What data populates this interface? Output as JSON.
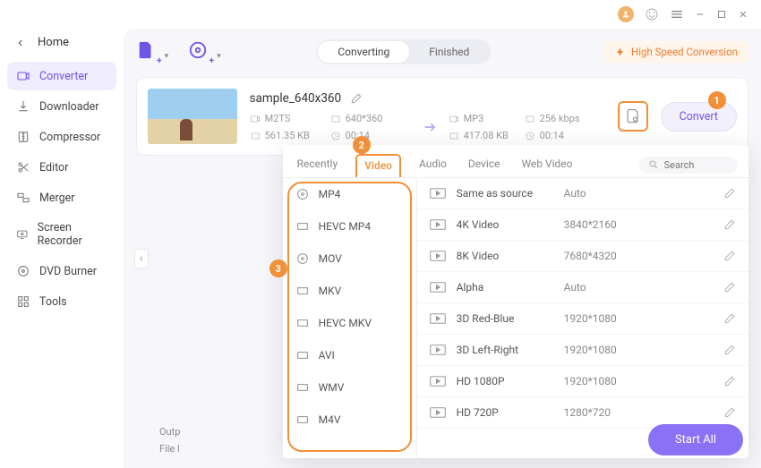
{
  "titlebar": {
    "user": "user"
  },
  "sidebar": {
    "back_label": "Home",
    "items": [
      {
        "label": "Converter"
      },
      {
        "label": "Downloader"
      },
      {
        "label": "Compressor"
      },
      {
        "label": "Editor"
      },
      {
        "label": "Merger"
      },
      {
        "label": "Screen Recorder"
      },
      {
        "label": "DVD Burner"
      },
      {
        "label": "Tools"
      }
    ]
  },
  "toprow": {
    "tabs": {
      "converting": "Converting",
      "finished": "Finished"
    },
    "highspeed": "High Speed Conversion"
  },
  "filecard": {
    "name": "sample_640x360",
    "src": {
      "fmt": "M2TS",
      "res": "640*360",
      "size": "561.35 KB",
      "dur": "00:14"
    },
    "dst": {
      "fmt": "MP3",
      "bitrate": "256 kbps",
      "size": "417.08 KB",
      "dur": "00:14"
    },
    "convert_label": "Convert"
  },
  "callouts": {
    "c1": "1",
    "c2": "2",
    "c3": "3"
  },
  "popup": {
    "tabs": {
      "recently": "Recently",
      "video": "Video",
      "audio": "Audio",
      "device": "Device",
      "webvideo": "Web Video"
    },
    "search_placeholder": "Search",
    "formats": [
      {
        "label": "MP4"
      },
      {
        "label": "HEVC MP4"
      },
      {
        "label": "MOV"
      },
      {
        "label": "MKV"
      },
      {
        "label": "HEVC MKV"
      },
      {
        "label": "AVI"
      },
      {
        "label": "WMV"
      },
      {
        "label": "M4V"
      }
    ],
    "presets": [
      {
        "name": "Same as source",
        "res": "Auto"
      },
      {
        "name": "4K Video",
        "res": "3840*2160"
      },
      {
        "name": "8K Video",
        "res": "7680*4320"
      },
      {
        "name": "Alpha",
        "res": "Auto"
      },
      {
        "name": "3D Red-Blue",
        "res": "1920*1080"
      },
      {
        "name": "3D Left-Right",
        "res": "1920*1080"
      },
      {
        "name": "HD 1080P",
        "res": "1920*1080"
      },
      {
        "name": "HD 720P",
        "res": "1280*720"
      }
    ]
  },
  "bottom": {
    "out_label": "Outp",
    "file_label": "File l",
    "startall": "Start All"
  }
}
